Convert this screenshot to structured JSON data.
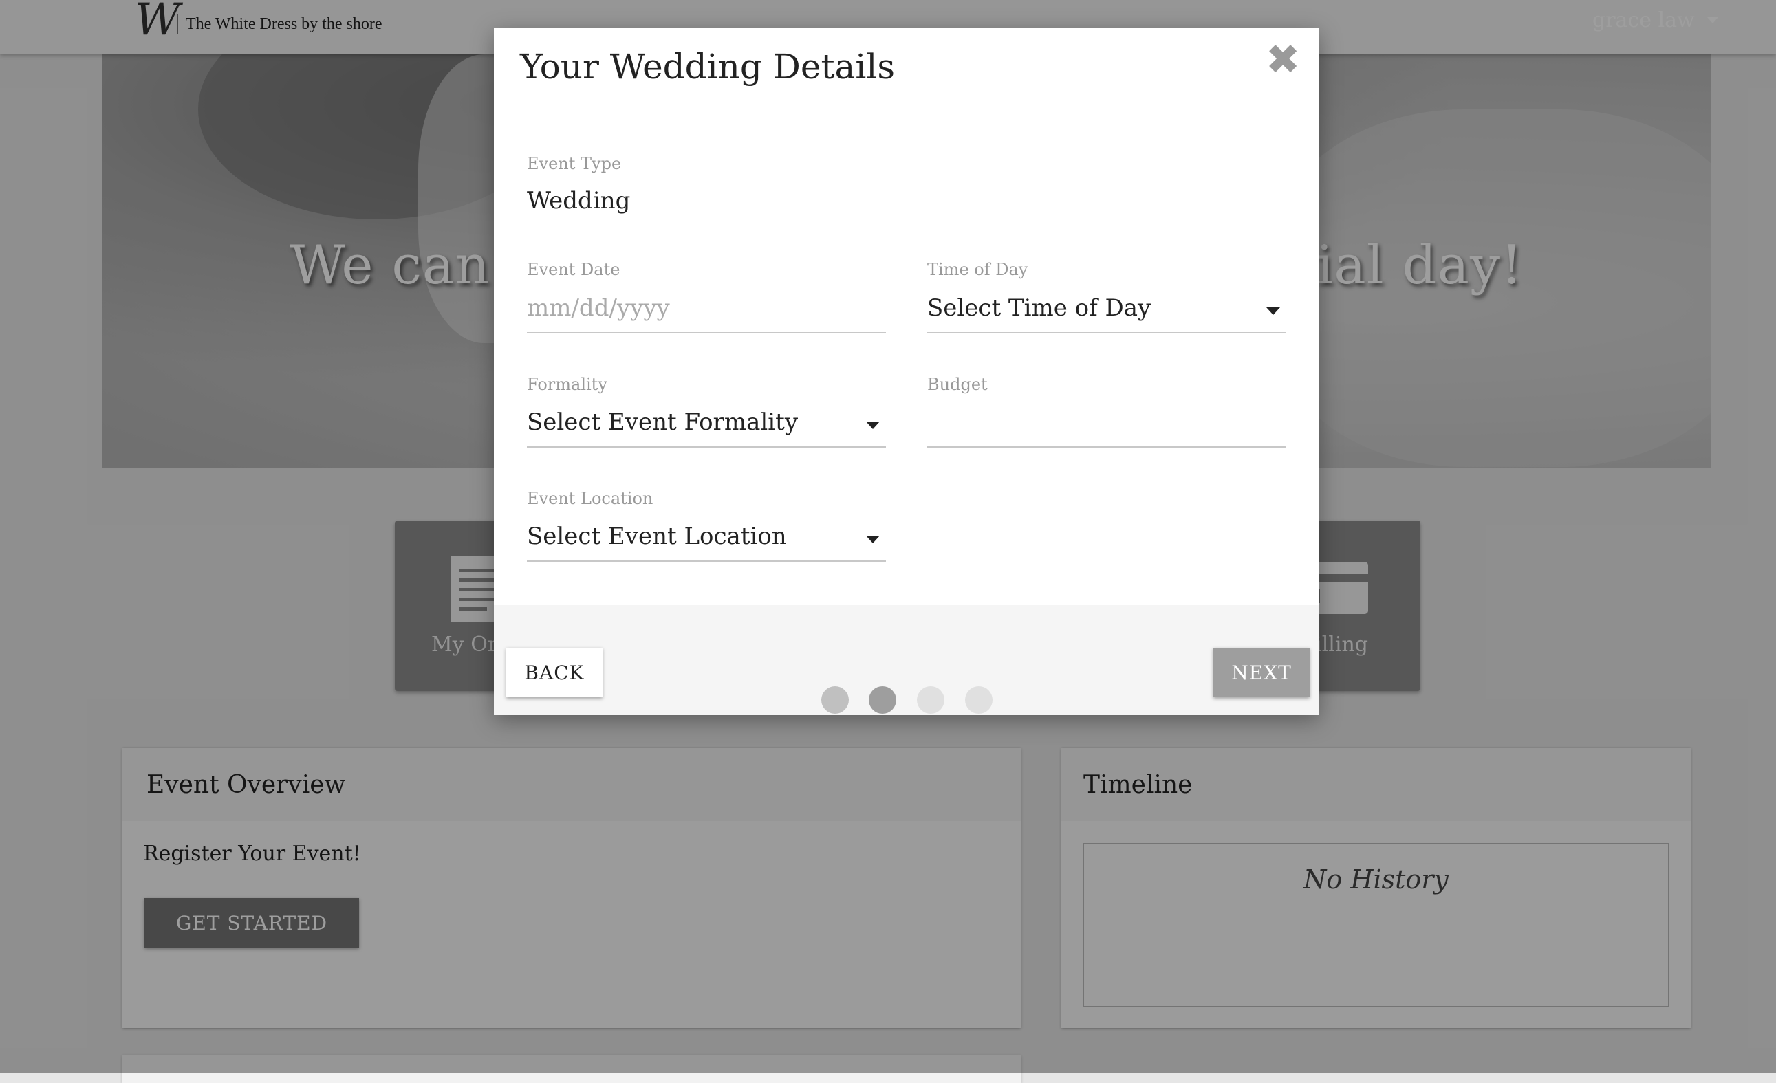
{
  "header": {
    "logo_mark": "W",
    "logo_text": "The White Dress by the shore",
    "user_name": "grace law"
  },
  "hero": {
    "title": "We can't wait to be part of your special day!"
  },
  "tiles": [
    {
      "label": "My Orders",
      "icon": "document-icon"
    },
    {
      "label": "Billing",
      "icon": "credit-card-icon"
    }
  ],
  "overview": {
    "title": "Event Overview",
    "register_text": "Register Your Event!",
    "get_started_label": "GET STARTED"
  },
  "timeline": {
    "title": "Timeline",
    "empty_text": "No History"
  },
  "modal": {
    "title": "Your Wedding Details",
    "close_icon": "✖",
    "fields": {
      "event_type": {
        "label": "Event Type",
        "value": "Wedding"
      },
      "event_date": {
        "label": "Event Date",
        "placeholder": "mm/dd/yyyy"
      },
      "time_of_day": {
        "label": "Time of Day",
        "value": "Select Time of Day"
      },
      "formality": {
        "label": "Formality",
        "value": "Select Event Formality"
      },
      "budget": {
        "label": "Budget",
        "value": ""
      },
      "event_location": {
        "label": "Event Location",
        "value": "Select Event Location"
      }
    },
    "back_label": "BACK",
    "next_label": "NEXT",
    "steps": {
      "total": 4,
      "current": 2
    }
  },
  "colors": {
    "navbar": "#f2f2f2",
    "tile": "#8d8d8d",
    "next_button": "#9e9e9e",
    "step_active": "#9e9e9e",
    "step_done": "#c0c0c0",
    "step_pending": "#e0e0e0"
  }
}
